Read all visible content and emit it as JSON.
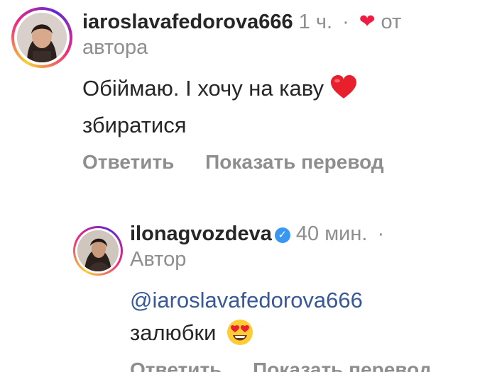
{
  "comment1": {
    "username": "iaroslavafedorova666",
    "time": "1 ч.",
    "separator": "·",
    "liked_label": "от",
    "liked_label_2": "автора",
    "text_line1": "Обіймаю. І хочу на каву",
    "text_line2": "збиратися",
    "reply_label": "Ответить",
    "translate_label": "Показать перевод"
  },
  "comment2": {
    "username": "ilonagvozdeva",
    "time": "40 мин.",
    "separator": "·",
    "role_label": "Автор",
    "mention": "@iaroslavafedorova666",
    "text": "залюбки",
    "reply_label": "Ответить",
    "translate_label": "Показать перевод"
  },
  "colors": {
    "username": "#262626",
    "meta": "#8e8e8e",
    "mention": "#385898",
    "heart": "#ed1c40",
    "verified": "#3897f0"
  },
  "icons": {
    "like_heart": "heart-icon",
    "verified_badge": "verified-badge-icon",
    "text_emoji_1": "red-heart-emoji",
    "text_emoji_2": "heart-eyes-emoji"
  }
}
